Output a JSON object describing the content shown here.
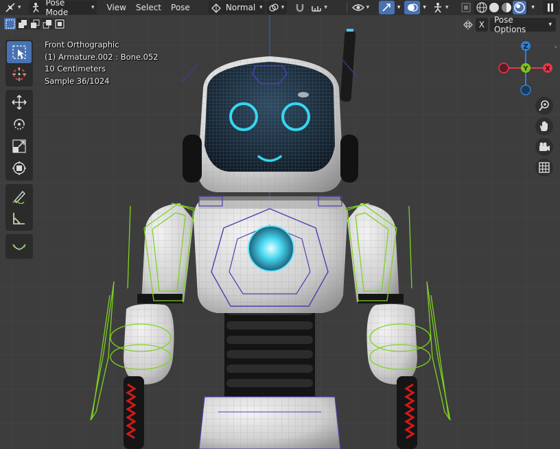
{
  "header": {
    "mode_label": "Pose Mode",
    "menu": [
      "View",
      "Select",
      "Pose"
    ],
    "transform_orientation": "Normal"
  },
  "subheader": {
    "x_label": "X",
    "pose_options_label": "Pose Options"
  },
  "overlay_info": {
    "view_name": "Front Orthographic",
    "active_object": "(1) Armature.002 : Bone.052",
    "scale": "10 Centimeters",
    "sample": "Sample 36/1024"
  },
  "gizmo": {
    "z_label": "Z",
    "y_label": "Y",
    "x_label": "X"
  },
  "colors": {
    "accent": "#4772b3",
    "axis_x": "#e8364c",
    "axis_y": "#7fc51d",
    "axis_z": "#2e7fd9",
    "bone_green": "#7ed321",
    "face_cyan": "#36d6f0"
  },
  "icons": {
    "editor_type": "armature-icon",
    "tools": [
      "tweak-icon",
      "cursor-icon",
      "move-icon",
      "rotate-icon",
      "scale-icon",
      "transform-icon",
      "annotate-icon",
      "measure-icon",
      "relax-icon"
    ],
    "nav": [
      "zoom-icon",
      "hand-icon",
      "camera-icon",
      "grid-icon"
    ]
  }
}
